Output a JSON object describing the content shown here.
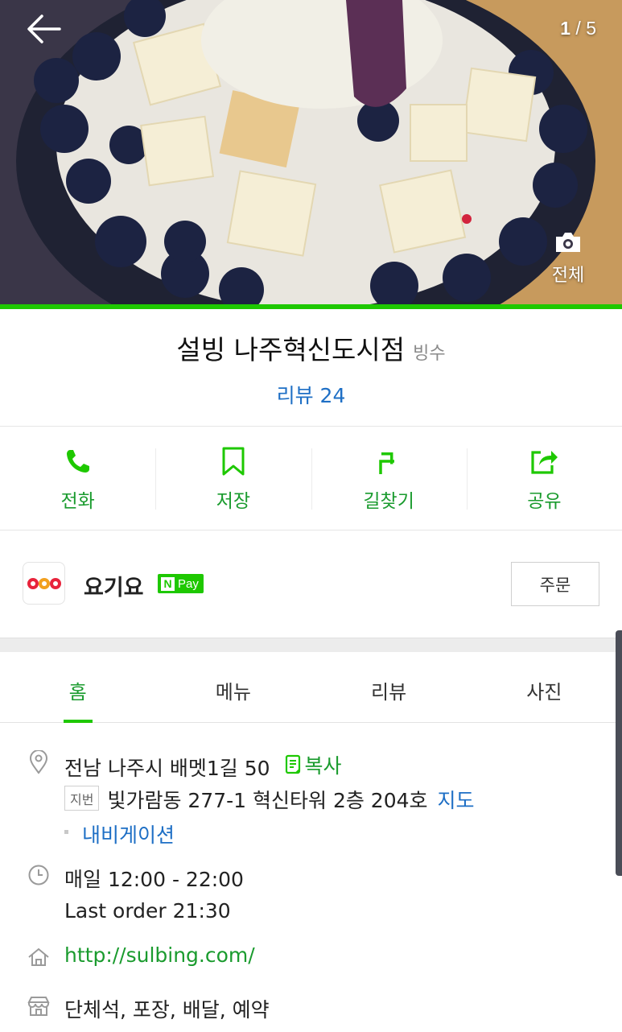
{
  "gallery": {
    "current": "1",
    "total": "/ 5",
    "all_photos_label": "전체"
  },
  "place": {
    "name": "설빙 나주혁신도시점",
    "category": "빙수",
    "review_label": "리뷰 24"
  },
  "actions": [
    {
      "label": "전화",
      "icon": "phone-icon"
    },
    {
      "label": "저장",
      "icon": "bookmark-icon"
    },
    {
      "label": "길찾기",
      "icon": "directions-icon"
    },
    {
      "label": "공유",
      "icon": "share-icon"
    }
  ],
  "order": {
    "service_name": "요기요",
    "npay_n": "N",
    "npay_text": "Pay",
    "button_label": "주문"
  },
  "tabs": [
    "홈",
    "메뉴",
    "리뷰",
    "사진"
  ],
  "info": {
    "address": "전남 나주시 배멧1길 50",
    "copy_label": "복사",
    "jibeon_badge": "지번",
    "jibeon_address": "빛가람동 277-1 혁신타워 2층 204호",
    "map_label": "지도",
    "navigation_label": "내비게이션",
    "hours": "매일 12:00 - 22:00",
    "last_order": "Last order 21:30",
    "website": "http://sulbing.com/",
    "facilities": "단체석, 포장, 배달, 예약"
  },
  "colors": {
    "accent_green": "#1ec800",
    "label_green": "#1a9b2e",
    "link_blue": "#1e6fc5"
  }
}
